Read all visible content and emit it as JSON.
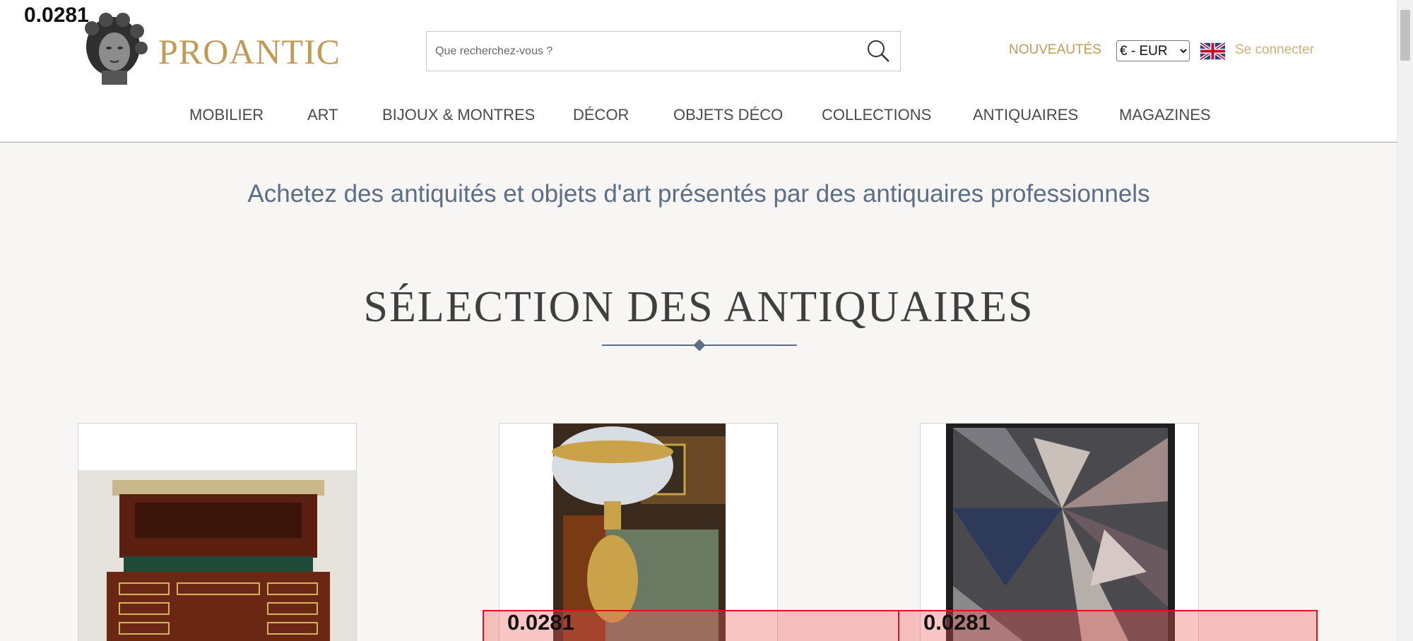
{
  "header": {
    "brand": "PROANTIC",
    "search": {
      "placeholder": "Que recherchez-vous ?",
      "value": ""
    },
    "new_link": "NOUVEAUTÉS",
    "currency": {
      "selected": "€ - EUR",
      "options": [
        "€ - EUR"
      ]
    },
    "language_flag": "uk-flag-icon",
    "login": "Se connecter"
  },
  "nav": {
    "items": [
      "MOBILIER",
      "ART",
      "BIJOUX & MONTRES",
      "DÉCOR",
      "OBJETS DÉCO",
      "COLLECTIONS",
      "ANTIQUAIRES",
      "MAGAZINES"
    ]
  },
  "main": {
    "tagline": "Achetez des antiquités et objets d'art présentés par des antiquaires professionnels",
    "section_title": "SÉLECTION DES ANTIQUAIRES",
    "cards": [
      {
        "image": "cylinder-desk-photo"
      },
      {
        "image": "crystal-vase-cherub-photo"
      },
      {
        "image": "abstract-stone-panel-photo"
      }
    ]
  },
  "overlays": {
    "top_left": "0.0281",
    "badge_1": "0.0281",
    "badge_2": "0.0281"
  },
  "colors": {
    "gold": "#bf9b57",
    "slate_blue": "#5c6e86",
    "overlay_red": "#e0141c"
  }
}
